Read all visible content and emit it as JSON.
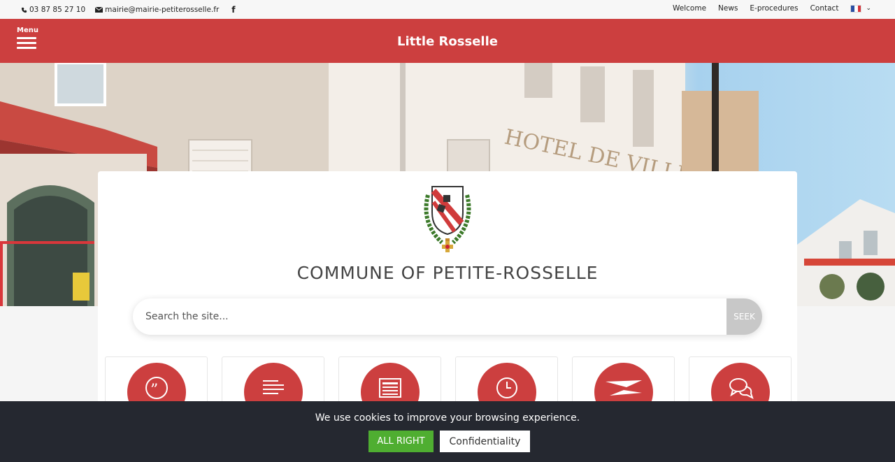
{
  "topbar": {
    "phone": "03 87 85 27 10",
    "email": "mairie@mairie-petiterosselle.fr",
    "nav": [
      "Welcome",
      "News",
      "E-procedures",
      "Contact"
    ],
    "language_flag": "flag-fr-icon"
  },
  "header": {
    "menu_label": "Menu",
    "site_title": "Little Rosselle"
  },
  "hero": {
    "sign_text": "HOTEL DE VILLE"
  },
  "main": {
    "title": "COMMUNE OF PETITE-ROSSELLE",
    "search": {
      "placeholder": "Search the site...",
      "button": "SEEK"
    },
    "tiles": [
      {
        "icon": "quote-icon"
      },
      {
        "icon": "text-lines-icon"
      },
      {
        "icon": "newspaper-icon"
      },
      {
        "icon": "clock-icon"
      },
      {
        "icon": "post-icon"
      },
      {
        "icon": "chat-bubbles-icon"
      }
    ]
  },
  "cookie": {
    "message": "We use cookies to improve your browsing experience.",
    "accept": "ALL RIGHT",
    "privacy": "Confidentiality"
  },
  "colors": {
    "brand_red": "#cc3f3f",
    "cookie_bg": "#252830",
    "accept_green": "#4fae31"
  }
}
